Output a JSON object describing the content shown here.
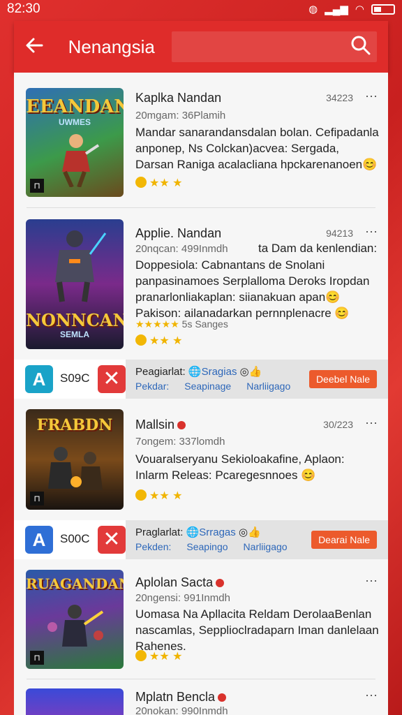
{
  "status": {
    "time": "82:30"
  },
  "appbar": {
    "title": "Nenangsia",
    "search_placeholder": ""
  },
  "cards": [
    {
      "thumb_title": "EEANDAN",
      "thumb_sub": "UWMES",
      "title": "Kaplka Nandan",
      "date": "34223",
      "meta": "20mgam: 36Plamih",
      "desc": "Mandar sanarandansdalan bolan. Cefipadanla anponep, Ns Colckan)acvea: Sergada, Darsan Raniga acalacliana hpckarenanoen😊",
      "rating": "★★ ★"
    },
    {
      "thumb_title": "NONNCAN",
      "thumb_sub": "SEMLA",
      "title": "Applie. Nandan",
      "date": "94213",
      "meta": "20nqcan: 499Inmdh",
      "meta_right": "ta Dam da kenlendian:",
      "desc": "Doppesiola: Cabnantans de Snolani panpasinamoes Serplalloma Deroks Iropdan pranarlonliakaplan: siianakuan apan😊 Pakison: ailanadarkan pernnplenacre 😊",
      "small_stars": "★★★★★",
      "small_stars_text": "5s  Sanges",
      "rating": "★★ ★"
    },
    {
      "thumb_title": "FRABDN",
      "thumb_sub": "",
      "title": "Mallsin",
      "date": "30/223",
      "meta": "7ongem: 337lomdh",
      "desc": "Vouaralseryanu Sekioloakafine, Aplaon: Inlarm Releas: Pcaregesnnoes 😊",
      "rating": "★★ ★"
    },
    {
      "thumb_title": "RUAGANDAN",
      "thumb_sub": "",
      "title": "Aplolan Sacta",
      "date": "",
      "meta": "20ngensi: 991Inmdh",
      "desc": "Uomasa Na Apllacita Reldam DerolaaBenlan nascamlas, Sepplioclradaparn Iman danlelaan Rahenes.",
      "rating": "★★ ★"
    },
    {
      "thumb_title": "",
      "thumb_sub": "",
      "title": "Mplatn Bencla",
      "date": "",
      "meta": "20nokan: 990Inmdh",
      "desc": "",
      "rating": ""
    }
  ],
  "ads": [
    {
      "code": "S09C",
      "line1_a": "Peagiarlat:",
      "line1_b": "Sragias",
      "line2_a": "Pekdar:",
      "line2_b": "Seapinage",
      "line2_c": "Narliigago",
      "cta": "Deebel Nale",
      "logo": "A",
      "logo_color": "#1aa3c8"
    },
    {
      "code": "S00C",
      "line1_a": "Praglarlat:",
      "line1_b": "Srragas",
      "line2_a": "Pekden:",
      "line2_b": "Seapingo",
      "line2_c": "Narliigago",
      "cta": "Dearai Nale",
      "logo": "A",
      "logo_color": "#2f6fd6"
    }
  ],
  "more_icon": "⋯",
  "colors": {
    "accent": "#df2c2a",
    "cta": "#ec5a2c"
  }
}
